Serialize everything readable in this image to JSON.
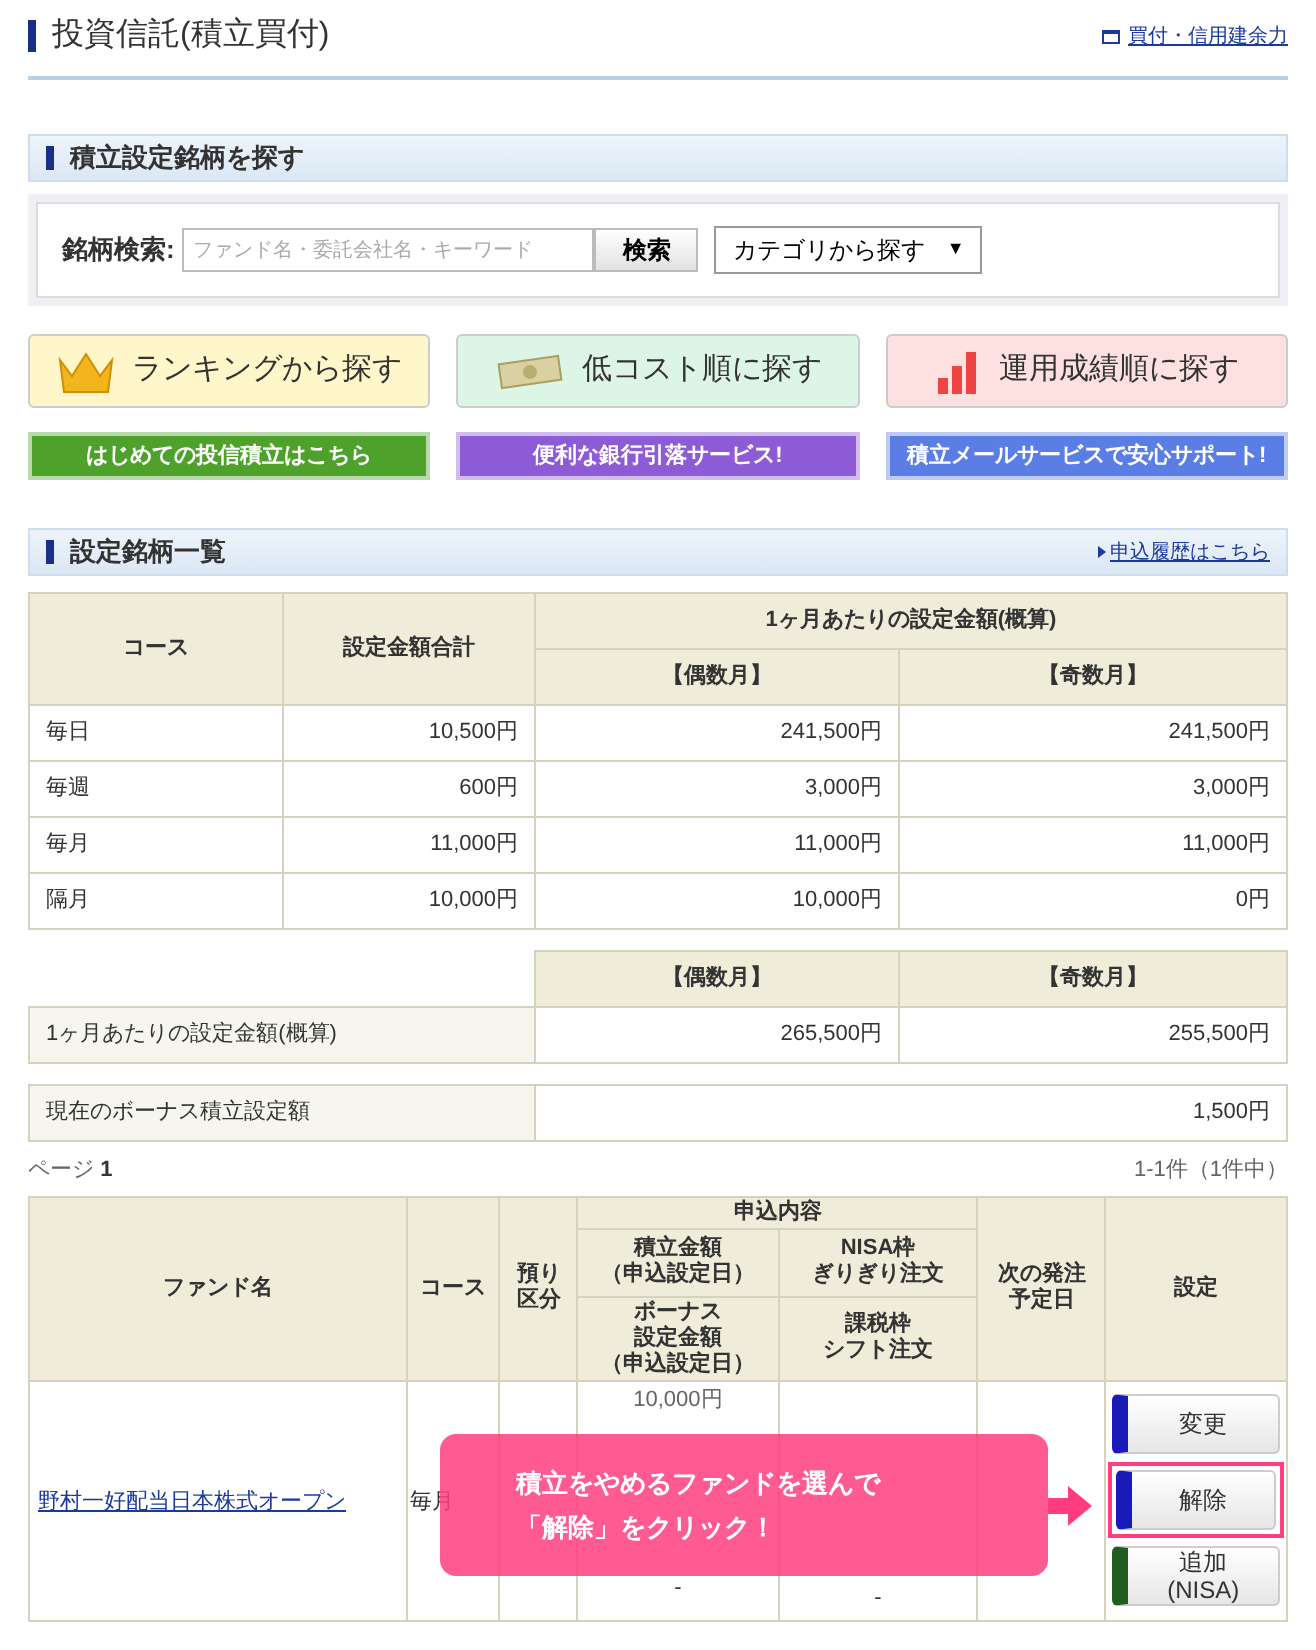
{
  "title": "投資信託(積立買付)",
  "header_link": "買付・信用建余力",
  "search_section": {
    "title": "積立設定銘柄を探す",
    "label": "銘柄検索:",
    "placeholder": "ファンド名・委託会社名・キーワード",
    "button": "検索",
    "category": "カテゴリから探す",
    "caret": "▼"
  },
  "search_buttons": [
    {
      "label": "ランキングから探す",
      "kind": "crown",
      "color": "#fff7c9"
    },
    {
      "label": "低コスト順に探す",
      "kind": "bill",
      "color": "#dcf5e6"
    },
    {
      "label": "運用成績順に探す",
      "kind": "bars",
      "color": "#fde0e0"
    }
  ],
  "banners": [
    {
      "label": "はじめての投信積立はこちら",
      "color": "#4ea12a"
    },
    {
      "label": "便利な銀行引落サービス!",
      "color": "#8e5bd6"
    },
    {
      "label": "積立メールサービスで安心サポート!",
      "color": "#5a7ee6"
    }
  ],
  "list_section": {
    "title": "設定銘柄一覧",
    "link": "申込履歴はこちら"
  },
  "summary_table": {
    "header_rows": [
      [
        {
          "text": "コース",
          "rowspan": 2
        },
        {
          "text": "設定金額合計",
          "rowspan": 2
        },
        {
          "text": "1ヶ月あたりの設定金額(概算)",
          "colspan": 2
        }
      ],
      [
        {
          "text": "【偶数月】"
        },
        {
          "text": "【奇数月】"
        }
      ]
    ],
    "rows": [
      [
        "毎日",
        "10,500円",
        "241,500円",
        "241,500円"
      ],
      [
        "毎週",
        "600円",
        "3,000円",
        "3,000円"
      ],
      [
        "毎月",
        "11,000円",
        "11,000円",
        "11,000円"
      ],
      [
        "隔月",
        "10,000円",
        "10,000円",
        "0円"
      ]
    ]
  },
  "monthly_table": {
    "columns": [
      "【偶数月】",
      "【奇数月】"
    ],
    "row": [
      "1ヶ月あたりの設定金額(概算)",
      "265,500円",
      "255,500円"
    ]
  },
  "bonus_row": [
    "現在のボーナス積立設定額",
    "1,500円"
  ],
  "pager": {
    "label": "ページ",
    "page": "1",
    "count": "1-1件（1件中）"
  },
  "fund_table": {
    "header_rows": [
      [
        {
          "lines": [
            "ファンド名"
          ],
          "rowspan": 3
        },
        {
          "lines": [
            "コース"
          ],
          "rowspan": 3
        },
        {
          "lines": [
            "預り",
            "区分"
          ],
          "rowspan": 3
        },
        {
          "lines": [
            "申込内容"
          ],
          "colspan": 2
        },
        {
          "lines": [
            "次の発注",
            "予定日"
          ],
          "rowspan": 3
        },
        {
          "lines": [
            "設定"
          ],
          "rowspan": 3
        }
      ],
      [
        {
          "lines": [
            "積立金額",
            "（申込設定日）"
          ]
        },
        {
          "lines": [
            "NISA枠",
            "ぎりぎり注文"
          ]
        }
      ],
      [
        {
          "lines": [
            "ボーナス",
            "設定金額",
            "（申込設定日）"
          ]
        },
        {
          "lines": [
            "課税枠",
            "シフト注文"
          ]
        }
      ]
    ],
    "row": {
      "fund": "野村一好配当日本株式オープン",
      "course": "毎月",
      "amount": "10,000円",
      "bonus": "-",
      "shift": "-"
    },
    "actions": [
      {
        "lines": [
          "変更"
        ],
        "color": "#1a1ab8",
        "highlighted": false
      },
      {
        "lines": [
          "解除"
        ],
        "color": "#1a1ab8",
        "highlighted": true
      },
      {
        "lines": [
          "追加",
          "(NISA)"
        ],
        "color": "#1f5e1f",
        "highlighted": false
      }
    ]
  },
  "callout": {
    "lines": [
      "積立をやめるファンドを選んで",
      "「解除」をクリック！"
    ]
  }
}
